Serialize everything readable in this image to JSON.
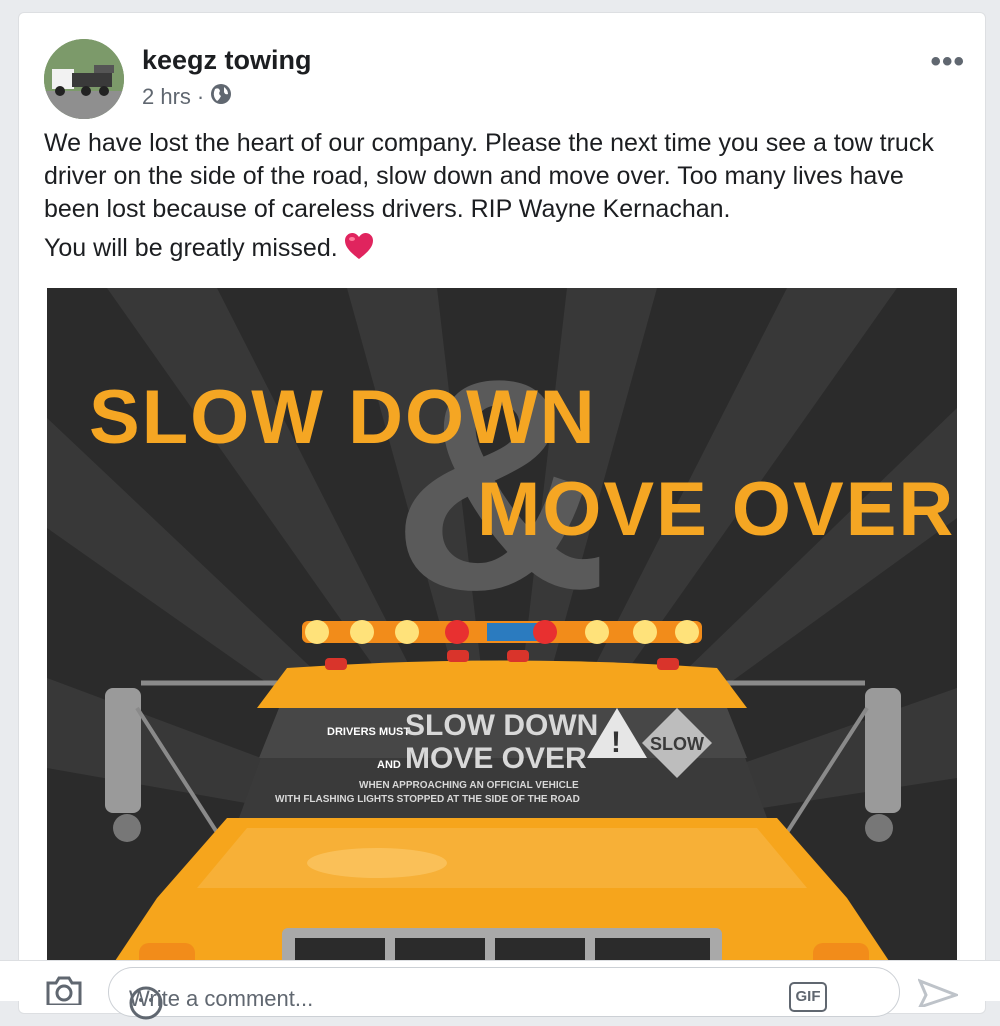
{
  "post": {
    "author": "keegz towing",
    "time": "2 hrs",
    "separator": "·",
    "privacy_icon": "globe-icon",
    "menu_icon": "more-options-icon",
    "menu_label": "•••",
    "text_line1": "We have lost the heart of our company. Please the next time you see a tow truck driver on the side of the road, slow down and move over. Too many lives have been lost because of careless drivers. RIP Wayne Kernachan.",
    "text_line2": "You will be greatly missed.",
    "emoji": "heart-icon"
  },
  "image": {
    "headline1": "SLOW DOWN",
    "headline2": "MOVE OVER",
    "ampersand": "&",
    "windshield_prefix1": "DRIVERS MUST",
    "windshield_line1": "SLOW DOWN",
    "windshield_prefix2": "AND",
    "windshield_line2": "MOVE OVER",
    "windshield_note1": "WHEN APPROACHING AN OFFICIAL VEHICLE",
    "windshield_note2": "WITH FLASHING LIGHTS STOPPED AT THE SIDE OF THE ROAD",
    "sign_slow": "SLOW",
    "sign_warning": "!",
    "colors": {
      "orange": "#f5a623",
      "background": "#2a2a2a",
      "truck": "#f6a51c"
    }
  },
  "comment_bar": {
    "placeholder": "Write a comment...",
    "camera_icon": "camera-icon",
    "gif_label": "GIF",
    "emoji_icon": "emoji-icon",
    "send_icon": "send-icon"
  }
}
